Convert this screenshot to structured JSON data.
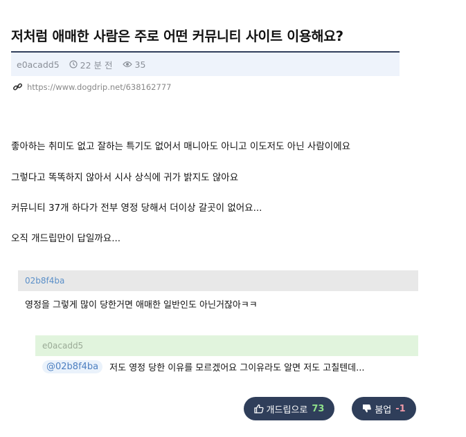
{
  "post": {
    "title": "저처럼 애매한 사람은 주로 어떤 커뮤니티 사이트 이용해요?",
    "author": "e0acadd5",
    "time": "22 분 전",
    "views": "35",
    "url": "https://www.dogdrip.net/638162777",
    "paragraphs": [
      "좋아하는 취미도 없고 잘하는 특기도 없어서 매니아도 아니고 이도저도 아닌 사람이에요",
      "그렇다고 똑똑하지 않아서 시사 상식에 귀가 밝지도 않아요",
      "커뮤니티 37개 하다가 전부 영정 당해서 더이상 갈곳이 없어요...",
      "오직 개드립만이 답일까요..."
    ]
  },
  "comments": [
    {
      "author": "02b8f4ba",
      "text": "영정을 그렇게 많이 당한거면 애매한 일반인도 아닌거잖아ㅋㅋ"
    },
    {
      "author": "e0acadd5",
      "mention": "@02b8f4ba",
      "text": "저도 영정 당한 이유를 모르겠어요 그이유라도 알면 저도 고칠텐데..."
    }
  ],
  "votes": {
    "up_label": "개드립으로",
    "up_count": "73",
    "down_label": "붐업",
    "down_count": "-1"
  },
  "icons": {
    "time": "clock-icon",
    "views": "eye-icon",
    "link": "link-icon",
    "up": "thumbs-up-icon",
    "down": "thumbs-down-icon"
  },
  "colors": {
    "accent": "#2f3e5a",
    "up_count": "#8fe08a",
    "down_count": "#f09aa8",
    "meta_bg": "#eef3fb",
    "reply_bg": "#e1f4dd"
  }
}
